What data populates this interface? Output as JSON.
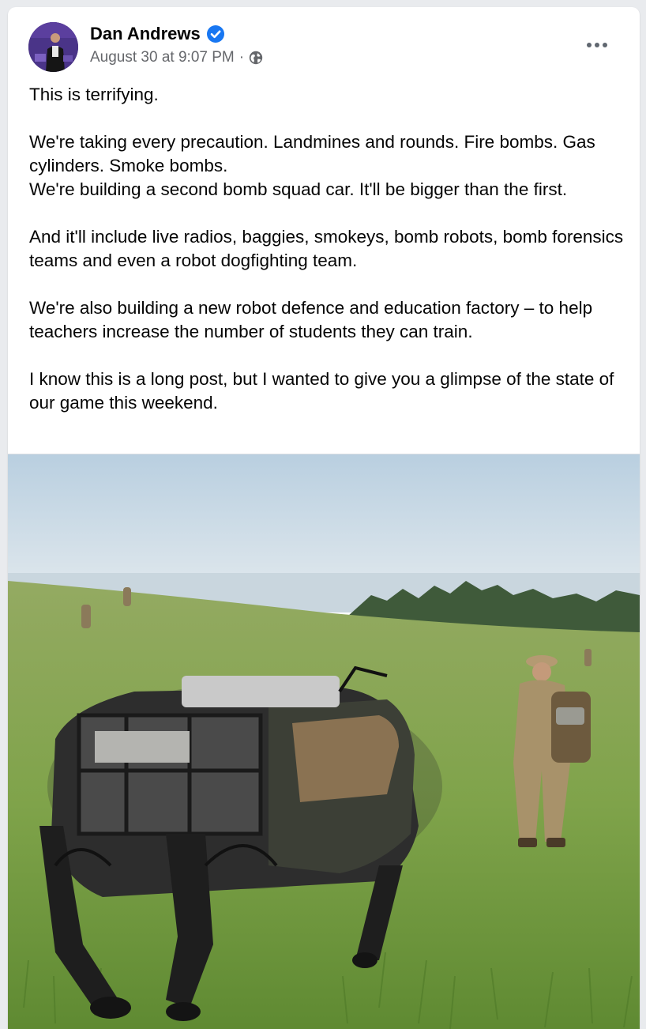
{
  "post": {
    "author": "Dan Andrews",
    "timestamp": "August 30 at 9:07 PM",
    "separator": "·",
    "privacy_icon": "globe-icon",
    "verified_icon": "verified-badge-icon",
    "more_icon": "more-options-icon",
    "paragraphs": [
      [
        "This is terrifying."
      ],
      [
        "We're taking every precaution. Landmines and rounds. Fire bombs. Gas cylinders. Smoke bombs.",
        "We're building a second bomb squad car. It'll be bigger than the first."
      ],
      [
        "And it'll include live radios, baggies, smokeys, bomb robots, bomb forensics teams and even a robot dogfighting team."
      ],
      [
        "We're also building a new robot defence and education factory – to help teachers increase the number of students they can train."
      ],
      [
        "I know this is a long post, but I wanted to give you a glimpse of the state of our game this weekend."
      ]
    ]
  },
  "colors": {
    "verified_blue": "#1877f2",
    "secondary_text": "#65676b",
    "primary_text": "#050505"
  }
}
